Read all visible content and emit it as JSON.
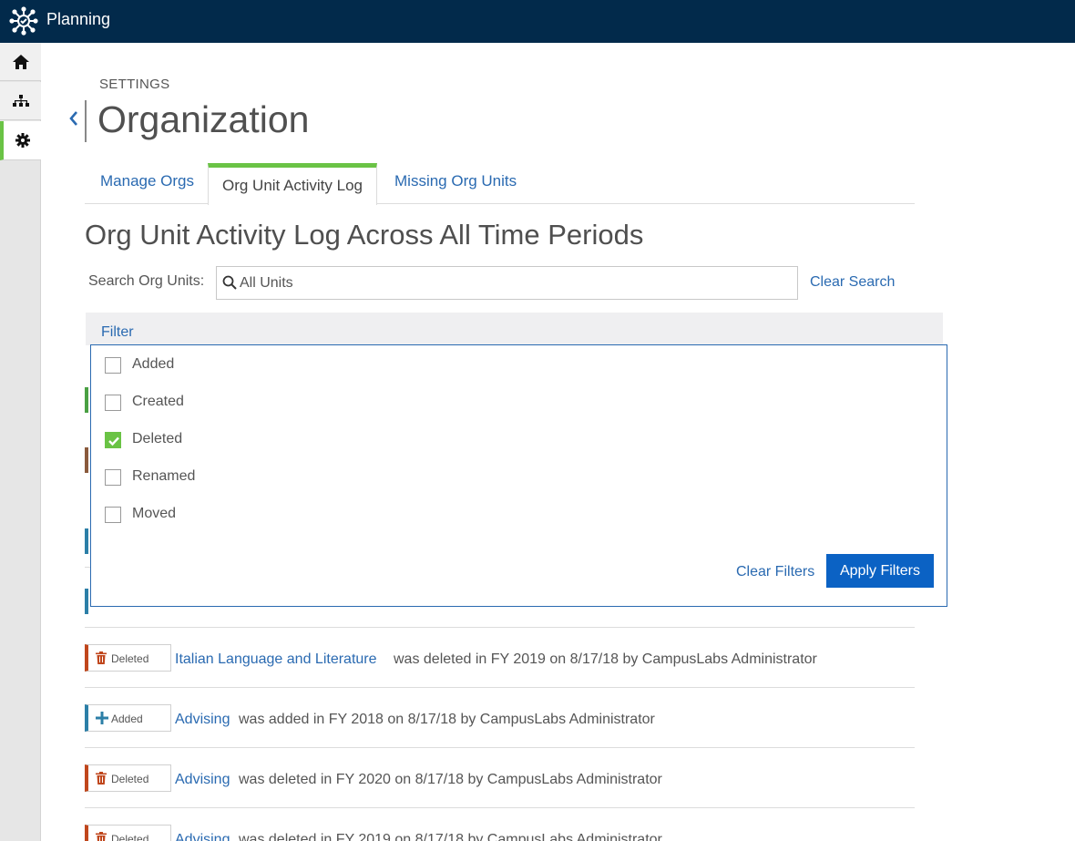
{
  "app": {
    "name": "Planning"
  },
  "rail": {
    "items": [
      "home-icon",
      "org-chart-icon",
      "gear-icon"
    ],
    "active": "gear-icon"
  },
  "header": {
    "section": "SETTINGS",
    "title": "Organization"
  },
  "tabs": [
    {
      "label": "Manage Orgs"
    },
    {
      "label": "Org Unit Activity Log"
    },
    {
      "label": "Missing Org Units"
    }
  ],
  "section_title": "Org Unit Activity Log Across All Time Periods",
  "search": {
    "label": "Search Org Units:",
    "placeholder": "All Units",
    "clear_label": "Clear Search"
  },
  "filter": {
    "label": "Filter",
    "options": [
      {
        "label": "Added",
        "checked": false
      },
      {
        "label": "Created",
        "checked": false
      },
      {
        "label": "Deleted",
        "checked": true
      },
      {
        "label": "Renamed",
        "checked": false
      },
      {
        "label": "Moved",
        "checked": false
      }
    ],
    "clear_label": "Clear Filters",
    "apply_label": "Apply Filters"
  },
  "rows": [
    {
      "type": "Deleted",
      "unit": "Italian Language and Literature",
      "text": "was deleted in FY 2019 on 8/17/18 by CampusLabs Administrator"
    },
    {
      "type": "Added",
      "unit": "Advising",
      "text": "was added in FY 2018 on 8/17/18 by CampusLabs Administrator"
    },
    {
      "type": "Deleted",
      "unit": "Advising",
      "text": "was deleted in FY 2020 on 8/17/18 by CampusLabs Administrator"
    },
    {
      "type": "Deleted",
      "unit": "Advising",
      "text": "was deleted in FY 2019 on 8/17/18 by CampusLabs Administrator"
    }
  ],
  "colors": {
    "topbar": "#022a4b",
    "accent_green": "#6ac345",
    "link": "#2a6ab1",
    "primary_button": "#0b62c4",
    "deleted": "#c0461c",
    "added": "#2c7fa7"
  }
}
